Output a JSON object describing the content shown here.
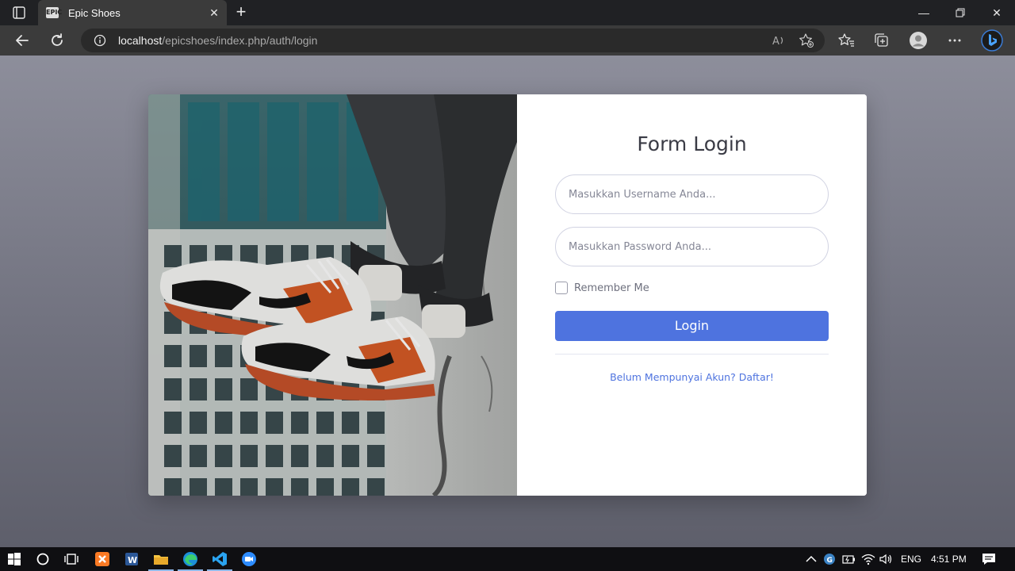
{
  "browser": {
    "tab_title": "Epic Shoes",
    "favicon_text": "EPIC",
    "url_host": "localhost",
    "url_path": "/epicshoes/index.php/auth/login"
  },
  "form": {
    "title": "Form Login",
    "username_placeholder": "Masukkan Username Anda...",
    "password_placeholder": "Masukkan Password Anda...",
    "remember_label": "Remember Me",
    "login_label": "Login",
    "register_link": "Belum Mempunyai Akun? Daftar!"
  },
  "colors": {
    "primary": "#4e73df",
    "page_background": "#7d7e8b",
    "browser_chrome": "#3b3b3b"
  },
  "taskbar": {
    "language": "ENG",
    "time": "4:51 PM",
    "apps": [
      "start-icon",
      "cortana-icon",
      "task-view-icon",
      "xampp-icon",
      "word-icon",
      "file-explorer-icon",
      "edge-icon",
      "vscode-icon",
      "zoom-icon"
    ]
  }
}
